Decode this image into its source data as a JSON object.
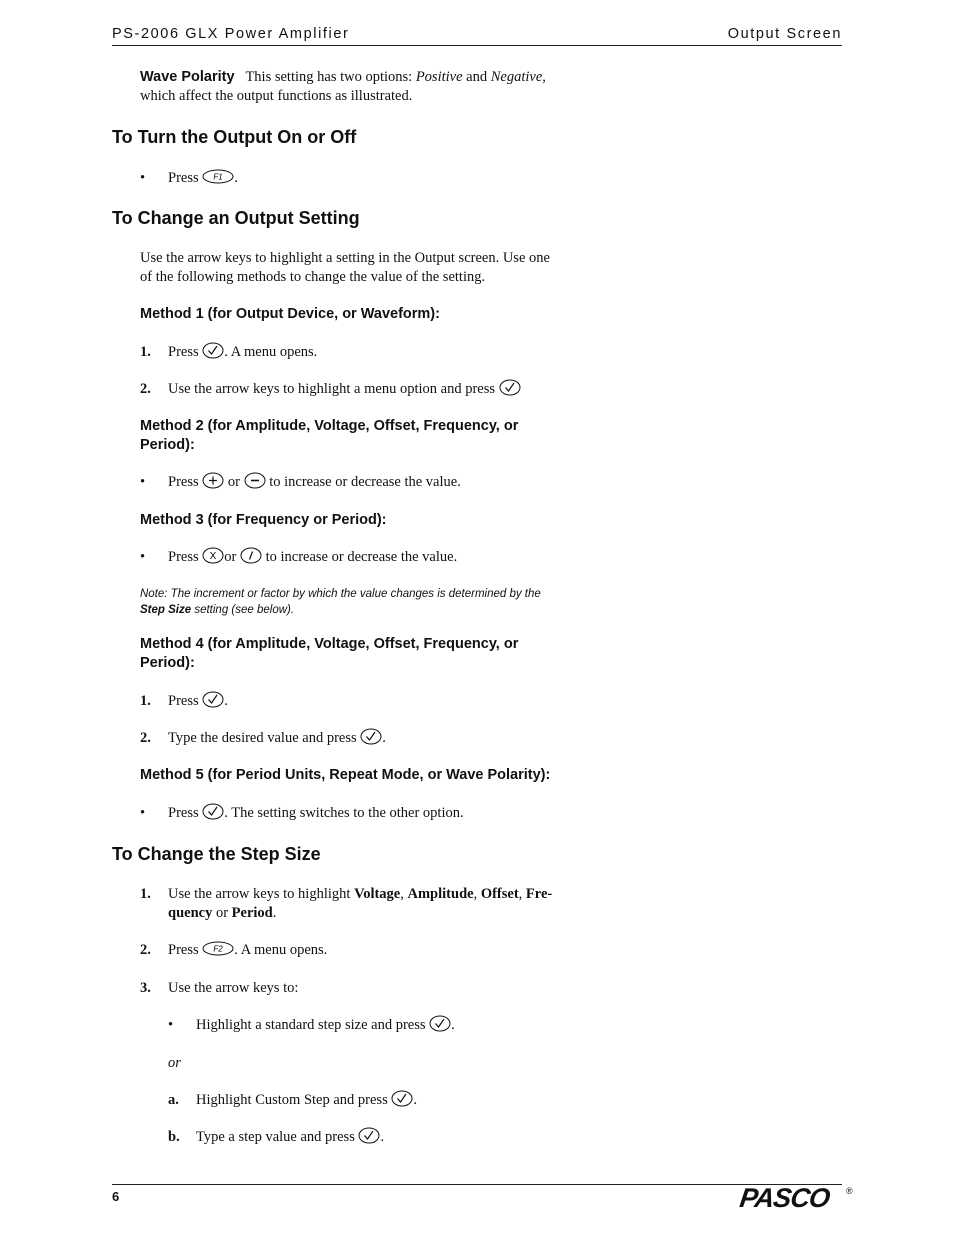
{
  "header": {
    "left": "PS-2006 GLX Power Amplifier",
    "right": "Output Screen"
  },
  "footer": {
    "page_number": "6",
    "logo": "PASCO",
    "registered": "®"
  },
  "wave_polarity": {
    "label": "Wave Polarity",
    "text_1": "This setting has two options: ",
    "opt_positive": "Positive",
    "text_and": " and ",
    "opt_negative": "Negative",
    "text_2": ",",
    "line_2": "which affect the output functions as illustrated."
  },
  "section_on_off": {
    "title": "To Turn the Output On or Off",
    "bullet": "•",
    "press": "Press",
    "key": "F1",
    "after": "."
  },
  "section_change": {
    "title": "To Change an Output Setting",
    "intro_1": "Use the arrow keys to highlight a setting in the Output screen. Use one",
    "intro_2": "of the following methods to change the value of the setting.",
    "method1": {
      "title": "Method 1 (for Output Device, or Waveform):",
      "steps": [
        {
          "num": "1.",
          "before": "Press",
          "after": ". A menu opens."
        },
        {
          "num": "2.",
          "before": "Use the arrow keys to highlight a menu option and press",
          "after": ""
        }
      ]
    },
    "method2": {
      "title_1": "Method 2 (for Amplitude, Voltage, Offset, Frequency, or",
      "title_2": "Period):",
      "bullet": "•",
      "press": "Press",
      "or": "or",
      "after": "to increase or decrease the value."
    },
    "method3": {
      "title": "Method 3 (for Frequency or Period):",
      "bullet": "•",
      "press": "Press",
      "key_x": "X",
      "or": "or",
      "key_div": "/",
      "after": "to increase or decrease the value."
    },
    "note": {
      "line_1": "Note: The increment or factor by which the value changes is determined by the",
      "bold": "Step Size",
      "line_2_rest": " setting (see below)."
    },
    "method4": {
      "title_1": "Method 4 (for Amplitude, Voltage, Offset, Frequency, or",
      "title_2": "Period):",
      "steps": [
        {
          "num": "1.",
          "before": "Press",
          "after": "."
        },
        {
          "num": "2.",
          "before": "Type the desired value and press",
          "after": "."
        }
      ]
    },
    "method5": {
      "title": "Method 5 (for Period Units, Repeat Mode, or Wave Polarity):",
      "bullet": "•",
      "press": "Press",
      "after": ". The setting switches to the other option."
    }
  },
  "section_step": {
    "title": "To Change the Step Size",
    "step1": {
      "num": "1.",
      "text_1": "Use the arrow keys to highlight ",
      "b_voltage": "Voltage",
      "c1": ", ",
      "b_amplitude": "Amplitude",
      "c2": ", ",
      "b_offset": "Offset",
      "c3": ", ",
      "b_fre": "Fre-",
      "b_quency": "quency",
      "or": " or ",
      "b_period": "Period",
      "end": "."
    },
    "step2": {
      "num": "2.",
      "press": "Press",
      "key": "F2",
      "after": ". A menu opens."
    },
    "step3": {
      "num": "3.",
      "text": "Use the arrow keys to:"
    },
    "sub_bullet": {
      "bullet": "•",
      "text": "Highlight a standard step size and press",
      "after": "."
    },
    "or": "or",
    "sub_a": {
      "label": "a.",
      "text": "Highlight Custom Step and press",
      "after": "."
    },
    "sub_b": {
      "label": "b.",
      "text": "Type a step value and press",
      "after": "."
    }
  }
}
